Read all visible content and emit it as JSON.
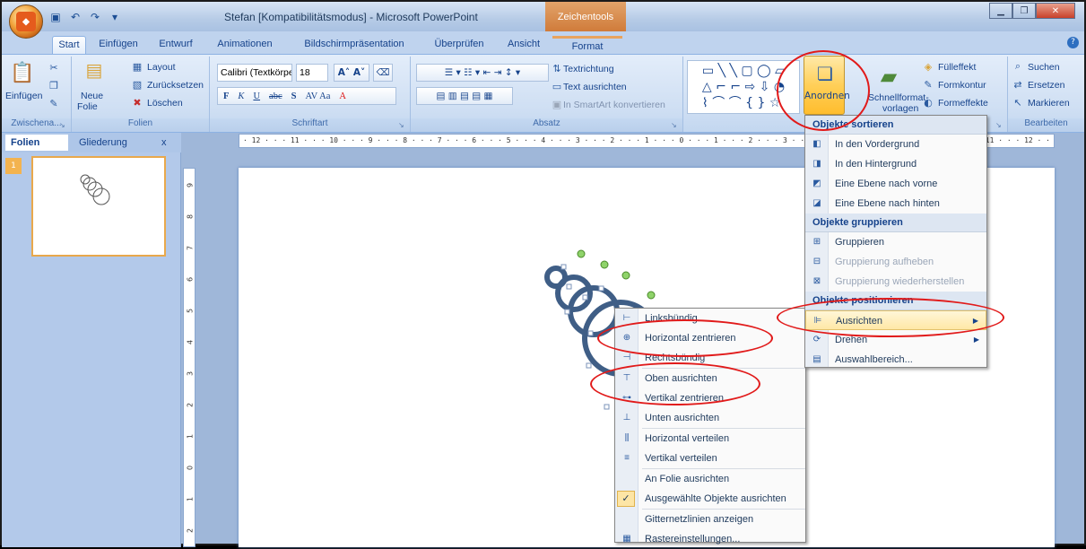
{
  "window": {
    "title": "Stefan [Kompatibilitätsmodus] - Microsoft PowerPoint",
    "tools_badge": "Zeichentools"
  },
  "tabs": [
    "Start",
    "Einfügen",
    "Entwurf",
    "Animationen",
    "Bildschirmpräsentation",
    "Überprüfen",
    "Ansicht",
    "Format"
  ],
  "ribbon": {
    "clipboard": {
      "label": "Zwischena...",
      "paste": "Einfügen"
    },
    "folien": {
      "label": "Folien",
      "new": "Neue",
      "new2": "Folie",
      "layout": "Layout",
      "reset": "Zurücksetzen",
      "delete": "Löschen"
    },
    "schriftart": {
      "label": "Schriftart",
      "font": "Calibri (Textkörpe",
      "size": "18"
    },
    "absatz": {
      "label": "Absatz",
      "textdir": "Textrichtung",
      "align": "Text ausrichten",
      "smartart": "In SmartArt konvertieren"
    },
    "zeichnung": {
      "arrange": "Anordnen",
      "styles1": "Schnellformat-",
      "styles2": "vorlagen",
      "fill": "Fülleffekt",
      "outline": "Formkontur",
      "effects": "Formeffekte"
    },
    "bearbeiten": {
      "label": "Bearbeiten",
      "find": "Suchen",
      "replace": "Ersetzen",
      "select": "Markieren"
    }
  },
  "pane": {
    "tab1": "Folien",
    "tab2": "Gliederung",
    "close": "x",
    "slide_no": "1"
  },
  "ruler": {
    "h": "· 12 · · · 11 · · · 10 · · · 9 · · · 8 · · · 7 · · · 6 · · · 5 · · · 4 · · · 3 · · · 2 · · · 1 · · · 0 · · · 1 · · · 2 · · · 3 · · · 4 · · ",
    "h_right": "11 · · · 12 · ·"
  },
  "arrange_menu": {
    "h1": "Objekte sortieren",
    "items1": [
      "In den Vordergrund",
      "In den Hintergrund",
      "Eine Ebene nach vorne",
      "Eine Ebene nach hinten"
    ],
    "h2": "Objekte gruppieren",
    "items2": [
      "Gruppieren",
      "Gruppierung aufheben",
      "Gruppierung wiederherstellen"
    ],
    "h3": "Objekte positionieren",
    "items3": [
      "Ausrichten",
      "Drehen",
      "Auswahlbereich..."
    ]
  },
  "align_menu": {
    "items": [
      "Linksbündig",
      "Horizontal zentrieren",
      "Rechtsbündig",
      "Oben ausrichten",
      "Vertikal zentrieren",
      "Unten ausrichten",
      "Horizontal verteilen",
      "Vertikal verteilen",
      "An Folie ausrichten",
      "Ausgewählte Objekte ausrichten",
      "Gitternetzlinien anzeigen",
      "Rastereinstellungen..."
    ]
  },
  "colors": {
    "accent": "#ffbd2e",
    "annotation": "#e11a1a",
    "shape": "#3f5e86"
  }
}
